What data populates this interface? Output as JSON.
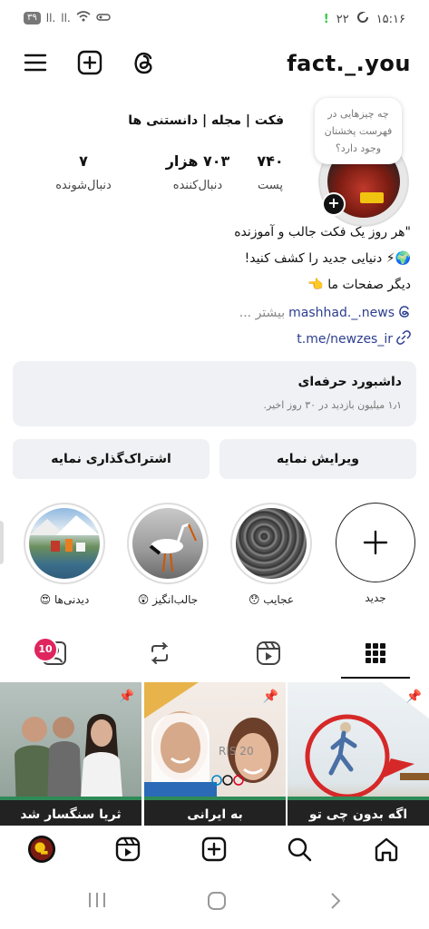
{
  "status_bar": {
    "battery": "۳۹",
    "signal_1": "ll.",
    "signal_2": "ll.",
    "alert": "!",
    "temperature": "۲۲",
    "time": "۱۵:۱۶"
  },
  "profile": {
    "username": "fact._.you",
    "note": "چه چیزهایی در فهرست پخشتان وجود دارد؟",
    "display_name": "فکت | مجله | دانستنی ها",
    "stats": [
      {
        "value": "۷۴۰",
        "label": "پست"
      },
      {
        "value": "۷۰۳ هزار",
        "label": "دنبال‌کننده"
      },
      {
        "value": "۷",
        "label": "دنبال‌شونده"
      }
    ],
    "bio_line_1": "\"هر روز یک فکت جالب و آموزنده",
    "bio_line_2": "🌍⚡ دنیایی جدید را کشف کنید!",
    "bio_line_3": "دیگر صفحات ما 👈",
    "threads_link": "mashhad._.news",
    "more_label": "... بیشتر",
    "link": "t.me/newzes_ir"
  },
  "dashboard": {
    "title": "داشبورد حرفه‌ای",
    "subtitle": "۱٫۱ میلیون بازدید در ۳۰ روز اخیر."
  },
  "buttons": {
    "edit_profile": "ویرایش نمایه",
    "share_profile": "اشتراک‌گذاری نمایه"
  },
  "highlights": [
    {
      "label": "جدید"
    },
    {
      "label": "عجایب 😯"
    },
    {
      "label": "جالب‌انگیز 😲"
    },
    {
      "label": "دیدنی‌ها 😍"
    }
  ],
  "tabs": {
    "tagged_badge": "10"
  },
  "posts": [
    {
      "caption": "اگه بدون چی تو استخره"
    },
    {
      "caption": "به ایرانی"
    },
    {
      "caption": "ثریا سنگسار شد"
    }
  ],
  "colors": {
    "accent_badge": "#e0245e",
    "link_blue": "#2c3e8f",
    "card_bg": "#eff1f4"
  }
}
